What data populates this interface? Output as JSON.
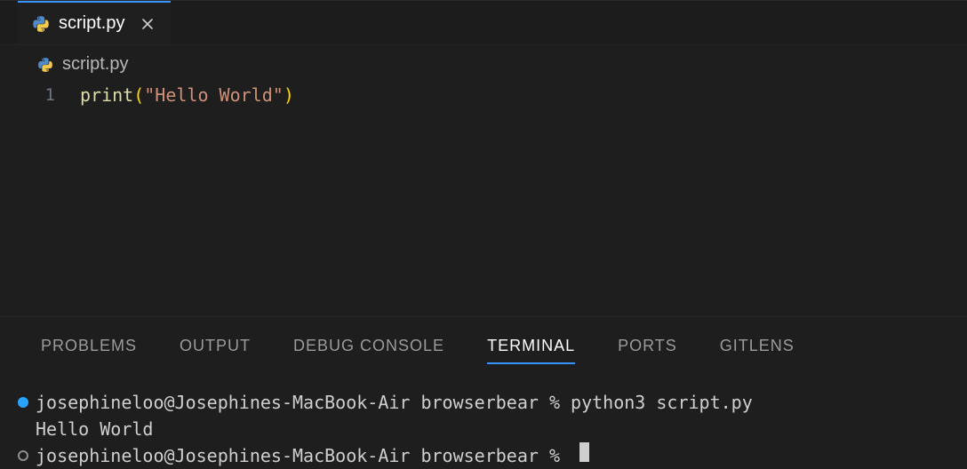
{
  "tab": {
    "filename": "script.py",
    "icon": "python-icon",
    "close_label": "Close"
  },
  "breadcrumb": {
    "filename": "script.py"
  },
  "editor": {
    "line_number": "1",
    "code": {
      "func": "print",
      "open": "(",
      "string": "\"Hello World\"",
      "close": ")"
    }
  },
  "panel_tabs": {
    "problems": "PROBLEMS",
    "output": "OUTPUT",
    "debug_console": "DEBUG CONSOLE",
    "terminal": "TERMINAL",
    "ports": "PORTS",
    "gitlens": "GITLENS",
    "active": "terminal"
  },
  "terminal": {
    "lines": [
      {
        "kind": "prompt",
        "dot": "filled",
        "text": "josephineloo@Josephines-MacBook-Air browserbear % python3 script.py"
      },
      {
        "kind": "output",
        "text": "Hello World"
      },
      {
        "kind": "prompt",
        "dot": "hollow",
        "text": "josephineloo@Josephines-MacBook-Air browserbear % ",
        "cursor": true
      }
    ]
  },
  "colors": {
    "accent": "#3794ff",
    "syntax_func": "#dcdcaa",
    "syntax_paren": "#ffd602",
    "syntax_string": "#ce9178"
  }
}
